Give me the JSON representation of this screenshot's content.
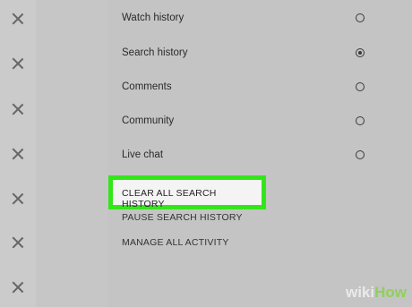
{
  "options": [
    {
      "label": "Watch history",
      "checked": false
    },
    {
      "label": "Search history",
      "checked": true
    },
    {
      "label": "Comments",
      "checked": false
    },
    {
      "label": "Community",
      "checked": false
    },
    {
      "label": "Live chat",
      "checked": false
    }
  ],
  "actions": {
    "clear_all": "CLEAR ALL SEARCH HISTORY",
    "pause": "PAUSE SEARCH HISTORY",
    "manage": "MANAGE ALL ACTIVITY"
  },
  "watermark": {
    "wiki": "wiki",
    "how": "How"
  },
  "colors": {
    "highlight": "#33e61a",
    "background": "#c4c4c4"
  },
  "icons": [
    "close-icon"
  ]
}
